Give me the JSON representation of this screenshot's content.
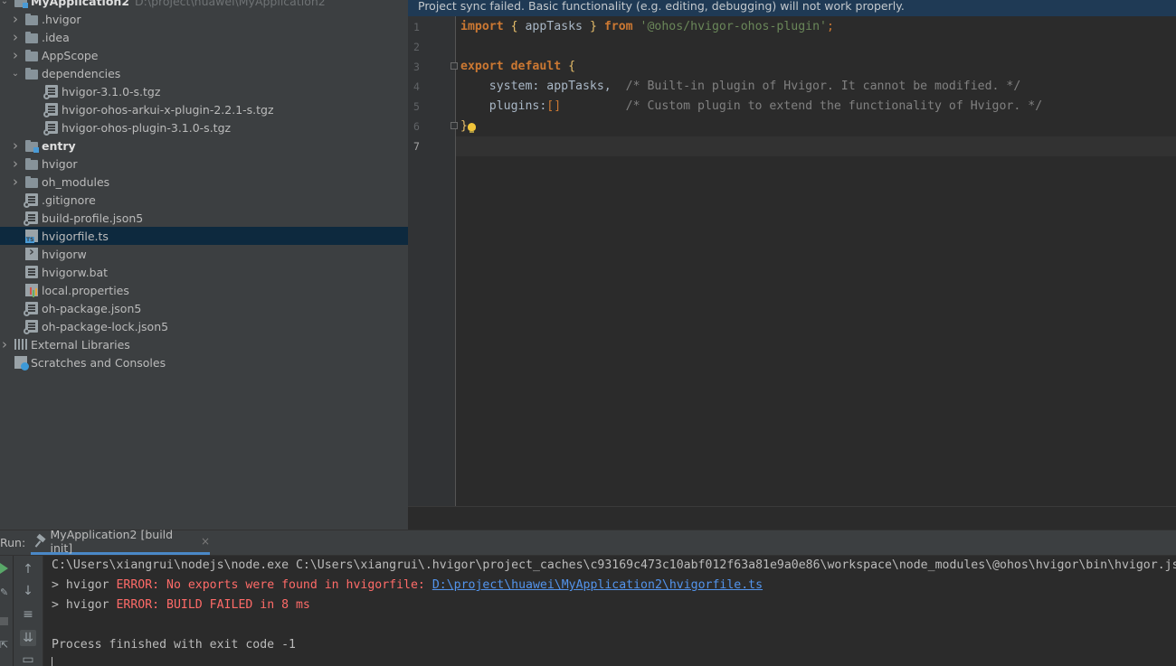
{
  "project_tree": {
    "root": {
      "label": "MyApplication2",
      "path": "D:\\project\\huawei\\MyApplication2"
    },
    "items": [
      {
        "label": ".hvigor",
        "type": "folder",
        "expand": "collapsed"
      },
      {
        "label": ".idea",
        "type": "folder",
        "expand": "collapsed"
      },
      {
        "label": "AppScope",
        "type": "folder",
        "expand": "collapsed"
      },
      {
        "label": "dependencies",
        "type": "folder",
        "expand": "expanded"
      },
      {
        "label": "hvigor-3.1.0-s.tgz",
        "type": "archive",
        "expand": "none"
      },
      {
        "label": "hvigor-ohos-arkui-x-plugin-2.2.1-s.tgz",
        "type": "archive",
        "expand": "none"
      },
      {
        "label": "hvigor-ohos-plugin-3.1.0-s.tgz",
        "type": "archive",
        "expand": "none"
      },
      {
        "label": "entry",
        "type": "module",
        "expand": "collapsed"
      },
      {
        "label": "hvigor",
        "type": "folder",
        "expand": "collapsed"
      },
      {
        "label": "oh_modules",
        "type": "folder",
        "expand": "collapsed"
      },
      {
        "label": ".gitignore",
        "type": "config",
        "expand": "none"
      },
      {
        "label": "build-profile.json5",
        "type": "config",
        "expand": "none"
      },
      {
        "label": "hvigorfile.ts",
        "type": "typescript",
        "expand": "none",
        "selected": true
      },
      {
        "label": "hvigorw",
        "type": "executable",
        "expand": "none"
      },
      {
        "label": "hvigorw.bat",
        "type": "file",
        "expand": "none"
      },
      {
        "label": "local.properties",
        "type": "properties",
        "expand": "none"
      },
      {
        "label": "oh-package.json5",
        "type": "config",
        "expand": "none"
      },
      {
        "label": "oh-package-lock.json5",
        "type": "config",
        "expand": "none"
      },
      {
        "label": "External Libraries",
        "type": "libraries",
        "expand": "collapsed"
      },
      {
        "label": "Scratches and Consoles",
        "type": "scratches",
        "expand": "none"
      }
    ]
  },
  "editor": {
    "sync_banner": "Project sync failed. Basic functionality (e.g. editing, debugging) will not work properly.",
    "line_numbers": [
      "1",
      "2",
      "3",
      "4",
      "5",
      "6",
      "7"
    ],
    "code": {
      "l1_import": "import",
      "l1_open": " { ",
      "l1_name": "appTasks",
      "l1_close": " } ",
      "l1_from": "from",
      "l1_space": " ",
      "l1_str": "'@ohos/hvigor-ohos-plugin'",
      "l1_semi": ";",
      "l3_export": "export default",
      "l3_brace": " {",
      "l4_key": "    system: appTasks,  ",
      "l4_comment": "/* Built-in plugin of Hvigor. It cannot be modified. */",
      "l5_key": "    plugins:",
      "l5_arr": "[]",
      "l5_pad": "         ",
      "l5_comment": "/* Custom plugin to extend the functionality of Hvigor. */",
      "l6_brace": "}"
    }
  },
  "run_panel": {
    "label": "Run:",
    "tab_label": "MyApplication2 [build init]",
    "tab_close": "×",
    "tool_icons": [
      "arrow-up-icon",
      "arrow-down-icon",
      "soft-wrap-icon",
      "scroll-to-end-icon",
      "print-icon"
    ],
    "console": {
      "cmd": "C:\\Users\\xiangrui\\nodejs\\node.exe C:\\Users\\xiangrui\\.hvigor\\project_caches\\c93169c473c10abf012f63a81e9a0e86\\workspace\\node_modules\\@ohos\\hvigor\\bin\\hvigor.js",
      "line2_prefix": "> hvigor ",
      "line2_error": "ERROR: No exports were found in hvigorfile: ",
      "line2_link": "D:\\project\\huawei\\MyApplication2\\hvigorfile.ts",
      "line3_prefix": "> hvigor ",
      "line3_error": "ERROR: BUILD FAILED in 8 ms",
      "exit": "Process finished with exit code -1"
    }
  },
  "colors": {
    "panel": "#3c3f41",
    "editor": "#2b2b2b",
    "selection": "#0d293e",
    "keyword": "#cc7832",
    "string": "#6a8759",
    "comment": "#808080",
    "error": "#ff6b68",
    "link": "#5394ec"
  }
}
